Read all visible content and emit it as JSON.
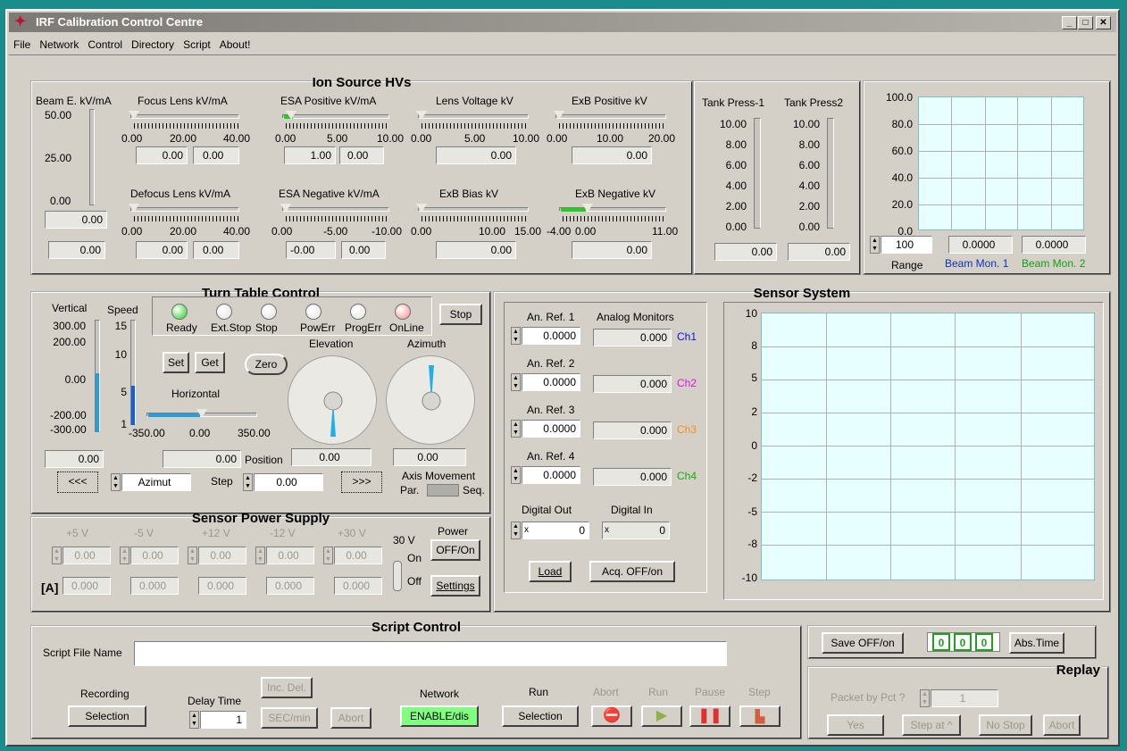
{
  "app": {
    "title": "IRF Calibration Control Centre"
  },
  "menu": [
    "File",
    "Network",
    "Control",
    "Directory",
    "Script",
    "About!"
  ],
  "ion": {
    "title": "Ion Source HVs",
    "beam_label": "Beam E. kV/mA",
    "beam_ticks": [
      "50.00",
      "25.00",
      "0.00"
    ],
    "beam_val": "0.00",
    "beam_val2": "0.00",
    "focus": {
      "label": "Focus Lens kV/mA",
      "scale": [
        "0.00",
        "20.00",
        "40.00"
      ],
      "v1": "0.00",
      "v2": "0.00"
    },
    "esa_pos": {
      "label": "ESA Positive kV/mA",
      "scale": [
        "0.00",
        "5.00",
        "10.00"
      ],
      "v1": "1.00",
      "v2": "0.00"
    },
    "lens": {
      "label": "Lens Voltage kV",
      "scale": [
        "0.00",
        "5.00",
        "10.00"
      ],
      "v1": "0.00"
    },
    "exb_pos": {
      "label": "ExB Positive kV",
      "scale": [
        "0.00",
        "10.00",
        "20.00"
      ],
      "v1": "0.00"
    },
    "defocus": {
      "label": "Defocus Lens kV/mA",
      "scale": [
        "0.00",
        "20.00",
        "40.00"
      ],
      "v1": "0.00",
      "v2": "0.00"
    },
    "esa_neg": {
      "label": "ESA Negative kV/mA",
      "scale": [
        "0.00",
        "-5.00",
        "-10.00"
      ],
      "v1": "-0.00",
      "v2": "0.00"
    },
    "exb_bias": {
      "label": "ExB Bias kV",
      "scale": [
        "0.00",
        "10.00",
        "15.00"
      ],
      "v1": "0.00"
    },
    "exb_neg": {
      "label": "ExB Negative kV",
      "scale": [
        "-4.00",
        "0.00",
        "11.00"
      ],
      "v1": "0.00"
    }
  },
  "tank": {
    "t1": "Tank Press-1",
    "t2": "Tank Press2",
    "ticks": [
      "10.00",
      "8.00",
      "6.00",
      "4.00",
      "2.00",
      "0.00"
    ],
    "v1": "0.00",
    "v2": "0.00"
  },
  "mon": {
    "yticks": [
      "100.0",
      "80.0",
      "60.0",
      "40.0",
      "20.0",
      "0.0"
    ],
    "range": "100",
    "range_label": "Range",
    "b1": "0.0000",
    "b2": "0.0000",
    "b1_label": "Beam Mon. 1",
    "b2_label": "Beam Mon. 2",
    "b1_color": "#1030c0",
    "b2_color": "#10a010"
  },
  "tt": {
    "title": "Turn Table Control",
    "vertical": "Vertical",
    "speed": "Speed",
    "vticks": [
      "300.00",
      "200.00",
      "0.00",
      "-200.00",
      "-300.00"
    ],
    "sticks": [
      "15",
      "10",
      "5",
      "1"
    ],
    "leds": [
      {
        "label": "Ready",
        "color": "#20d020"
      },
      {
        "label": "Ext.Stop",
        "color": "#e6e4e0"
      },
      {
        "label": "Stop",
        "color": "#e6e4e0"
      },
      {
        "label": "PowErr",
        "color": "#e6e4e0"
      },
      {
        "label": "ProgErr",
        "color": "#e6e4e0"
      },
      {
        "label": "OnLine",
        "color": "#f09090"
      }
    ],
    "stop": "Stop",
    "set": "Set",
    "get": "Get",
    "zero": "Zero",
    "horizontal": "Horizontal",
    "hticks": [
      "-350.00",
      "0.00",
      "350.00"
    ],
    "elevation": "Elevation",
    "azimuth": "Azimuth",
    "vval": "0.00",
    "hval": "0.00",
    "position": "Position",
    "elev_val": "0.00",
    "azi_val": "0.00",
    "prev": "<<<",
    "next": ">>>",
    "azimut": "Azimut",
    "step": "Step",
    "step_val": "0.00",
    "axis": "Axis Movement",
    "par": "Par.",
    "seq": "Seq."
  },
  "sps": {
    "title": "Sensor Power Supply",
    "cols": [
      "+5 V",
      "-5 V",
      "+12 V",
      "-12 V",
      "+30 V"
    ],
    "vals": [
      "0.00",
      "0.00",
      "0.00",
      "0.00",
      "0.00"
    ],
    "amps": [
      "0.000",
      "0.000",
      "0.000",
      "0.000",
      "0.000"
    ],
    "amp_label": "[A]",
    "v30": "30 V",
    "on": "On",
    "off": "Off",
    "power": "Power",
    "power_btn": "OFF/On",
    "settings": "Settings"
  },
  "sensor": {
    "title": "Sensor System",
    "refs": [
      {
        "label": "An. Ref. 1",
        "val": "0.0000",
        "mon": "0.000",
        "ch": "Ch1",
        "color": "#1010e0"
      },
      {
        "label": "An. Ref. 2",
        "val": "0.0000",
        "mon": "0.000",
        "ch": "Ch2",
        "color": "#e010e0"
      },
      {
        "label": "An. Ref. 3",
        "val": "0.0000",
        "mon": "0.000",
        "ch": "Ch3",
        "color": "#f09020"
      },
      {
        "label": "An. Ref. 4",
        "val": "0.0000",
        "mon": "0.000",
        "ch": "Ch4",
        "color": "#10b010"
      }
    ],
    "analog": "Analog Monitors",
    "dout": "Digital Out",
    "din": "Digital In",
    "dout_val": "0",
    "din_val": "0",
    "dout_prefix": "x",
    "din_prefix": "x",
    "load": "Load",
    "acq": "Acq. OFF/on",
    "yticks": [
      "10",
      "8",
      "5",
      "2",
      "0",
      "-2",
      "-5",
      "-8",
      "-10"
    ]
  },
  "script": {
    "title": "Script Control",
    "file_label": "Script File Name",
    "file_val": "",
    "recording": "Recording",
    "selection": "Selection",
    "delay": "Delay Time",
    "delay_val": "1",
    "incdel": "Inc. Del.",
    "secmin": "SEC/min",
    "abort": "Abort",
    "network": "Network",
    "enable": "ENABLE/dis",
    "run": "Run",
    "run_sel": "Selection",
    "abort2": "Abort",
    "run2": "Run",
    "pause": "Pause",
    "step": "Step"
  },
  "save": {
    "save": "Save OFF/on",
    "d": [
      "0",
      "0",
      "0"
    ],
    "abstime": "Abs.Time"
  },
  "replay": {
    "title": "Replay",
    "packet": "Packet by Pct ?",
    "packet_val": "1",
    "yes": "Yes",
    "stepat": "Step at ^",
    "nostop": "No Stop",
    "abort": "Abort"
  }
}
